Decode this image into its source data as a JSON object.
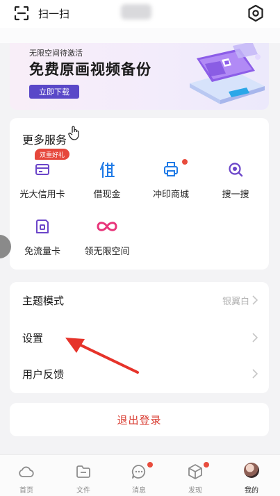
{
  "header": {
    "scan_label": "扫一扫"
  },
  "banner": {
    "subtitle": "无限空间待激活",
    "title": "免费原画视频备份",
    "button": "立即下载"
  },
  "services": {
    "title": "更多服务",
    "items": [
      {
        "label": "光大信用卡",
        "badge": "双重好礼",
        "icon": "credit-card-icon"
      },
      {
        "label": "借现金",
        "icon": "borrow-icon"
      },
      {
        "label": "冲印商城",
        "icon": "printer-icon",
        "dot": true
      },
      {
        "label": "搜一搜",
        "icon": "search-icon"
      },
      {
        "label": "免流量卡",
        "icon": "sim-card-icon"
      },
      {
        "label": "领无限空间",
        "icon": "infinity-icon"
      }
    ]
  },
  "settings": {
    "rows": [
      {
        "label": "主题模式",
        "value": "银翼白"
      },
      {
        "label": "设置",
        "value": ""
      },
      {
        "label": "用户反馈",
        "value": ""
      }
    ]
  },
  "logout": "退出登录",
  "nav": [
    {
      "label": "首页",
      "icon": "cloud-icon"
    },
    {
      "label": "文件",
      "icon": "folder-icon"
    },
    {
      "label": "消息",
      "icon": "message-icon",
      "dot": true
    },
    {
      "label": "发现",
      "icon": "cube-icon",
      "dot": true
    },
    {
      "label": "我的",
      "icon": "avatar",
      "active": true
    }
  ],
  "colors": {
    "accent": "#5a48c8",
    "danger": "#d83a2f",
    "dot": "#e84c3d",
    "icon_purple": "#6b45c9",
    "icon_blue": "#1f7ae6",
    "icon_pink": "#e8357a"
  }
}
